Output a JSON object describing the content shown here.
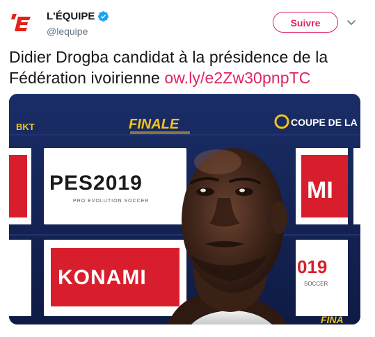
{
  "tweet": {
    "author_name": "L'ÉQUIPE",
    "author_handle": "@lequipe",
    "follow_label": "Suivre",
    "text": "Didier Drogba candidat à la présidence de la Fédération ivoirienne ",
    "link": "ow.ly/e2Zw30pnpTC"
  },
  "media": {
    "backdrop_texts": {
      "finale": "FINALE",
      "coupe": "COUPE DE LA",
      "bkt": "BKT",
      "pes": "PES2019",
      "pes_sub": "PRO EVOLUTION SOCCER",
      "konami": "KONAMI",
      "mi": "MI",
      "nineteen": "019",
      "soccer": "SOCCER",
      "fina": "FINA"
    }
  },
  "colors": {
    "accent": "#e0245e",
    "verified": "#1da1f2",
    "backdrop_navy": "#16285c",
    "konami_red": "#d81e2c"
  },
  "icons": {
    "avatar": "lequipe-logo-icon",
    "verified": "verified-badge-icon",
    "more": "chevron-down-icon"
  }
}
